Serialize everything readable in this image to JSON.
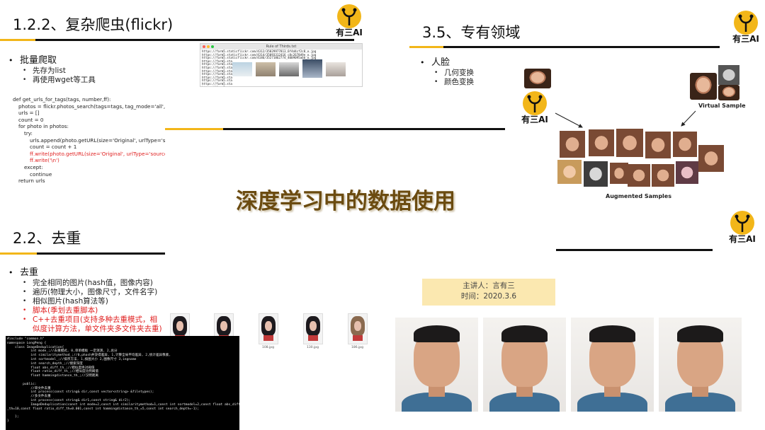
{
  "logo": {
    "text": "有三AI"
  },
  "section_flickr": {
    "title": "1.2.2、复杂爬虫(flickr)",
    "bullet": "批量爬取",
    "sub": [
      "先存为list",
      "再使用wget等工具"
    ],
    "code_lines": [
      {
        "t": "def get_urls_for_tags(tags, number,ff):",
        "i": 0,
        "red": false
      },
      {
        "t": "photos = flickr.photos_search(tags=tags, tag_mode='all', per_pa",
        "i": 1,
        "red": false
      },
      {
        "t": "urls = []",
        "i": 1,
        "red": false
      },
      {
        "t": "count = 0",
        "i": 1,
        "red": false
      },
      {
        "t": "for photo in photos:",
        "i": 1,
        "red": false
      },
      {
        "t": "try:",
        "i": 2,
        "red": false
      },
      {
        "t": "urls.append(photo.getURL(size='Original', urlType='source",
        "i": 3,
        "red": false
      },
      {
        "t": "count = count + 1",
        "i": 3,
        "red": false
      },
      {
        "t": "ff.write(photo.getURL(size='Original', urlType='source'))",
        "i": 3,
        "red": true
      },
      {
        "t": "ff.write('\\n')",
        "i": 3,
        "red": true
      },
      {
        "t": "except:",
        "i": 2,
        "red": false
      },
      {
        "t": "continue",
        "i": 3,
        "red": false
      },
      {
        "t": "return urls",
        "i": 1,
        "red": false
      }
    ],
    "window_title": "Rule of Thirds.txt",
    "window_lines": [
      "https://farm5.staticflickr.com/4312/35829977813_6f4d4cf2c8_o.jpg",
      "https://farm5.staticflickr.com/4314/35093312416_c8c2678d9e_o.jpg",
      "https://farm5.staticflickr.com/4186/35271862774_4009095a6b_o.jpg",
      "https://farm5.sta",
      "https://farm5.sta",
      "https://farm5.sta",
      "https://farm5.sta",
      "https://farm5.sta",
      "https://farm5.sta",
      "https://farm5.sta",
      "https://farm5.sta",
      "https://farm5.sta"
    ]
  },
  "section_domain": {
    "title": "3.5、专有领域",
    "bullet": "人脸",
    "sub": [
      "几何变换",
      "颜色变换"
    ],
    "virtual_label": "Virtual Sample",
    "augmented_label": "Augmented Samples"
  },
  "center_title": "深度学习中的数据使用",
  "section_dedup": {
    "title": "2.2、去重",
    "bullet": "去重",
    "sub": [
      {
        "t": "完全相同的图片(hash值，图像内容)",
        "red": false
      },
      {
        "t": "遍历(物理大小，图像尺寸，文件名字)",
        "red": false
      },
      {
        "t": "相似图片(hash算法等)",
        "red": false
      },
      {
        "t": "脚本(季划去重脚本)",
        "red": true
      },
      {
        "t": "C++去重项目(支持多种去重模式，相",
        "red": true
      }
    ],
    "sub_cont": "似度计算方法，单文件夹多文件夹去重)",
    "thumb_labels": [
      "",
      "",
      "108.jpg",
      "130.jpg",
      "186.jpg"
    ],
    "code_lines": [
      "#include \"common.h\"",
      "namespace LongPeng {",
      "    class ImageDeduplication{",
      "            int mode_;//去重模式, 0,单单模板 一定演演, 2,总分",
      "            int similaritymethod_;//0,phash并没得差异, 1,计算全局平均差异, 2,统计差异像素,",
      "            int sortmodel_;//排序方法, 1,按图大小 2,图像尺寸 3,ingname",
      "            int search_depth_;//搜索深度",
      "            float abs_diff_th_;//相似度绝对阈值",
      "            float ratio_diff_th_;//相似度比例阈值",
      "            float hammingdistance_th_;//汉明距离",
      "",
      "        public:",
      "            //单文件去重",
      "            int process(const string& dir,const vector<string> &filetypes);",
      "            //多文件去重",
      "            int process(const string& dir1,const string& dir2);",
      "            ImageDeduplication(const int mode=2,const int similaritymethod=1,const int sortmodel=2,const float abs_diff",
      "_th=10,const float ratio_diff_th=0.001,const int hammingdistance_th_=5,const int search_depth=-1);",
      "",
      "    };",
      "}"
    ]
  },
  "speaker": {
    "line1": "主讲人：言有三",
    "line2": "时间：2020.3.6"
  },
  "colors": {
    "accent": "#f2b619",
    "dark": "#111111",
    "red": "#e02020",
    "note_bg": "#fbe8b0"
  }
}
